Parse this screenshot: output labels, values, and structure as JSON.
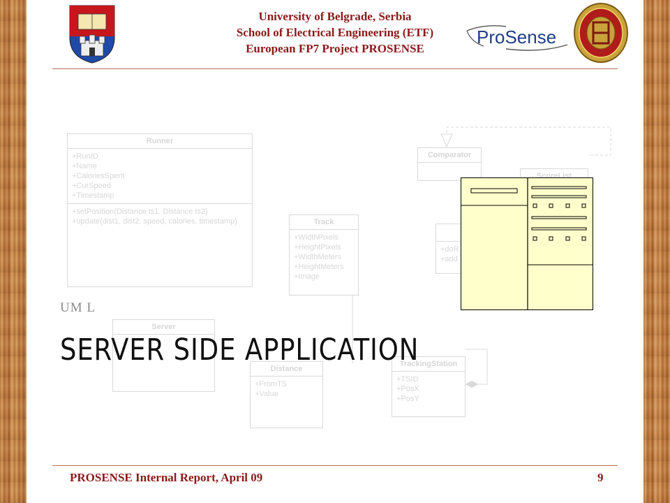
{
  "header": {
    "line1": "University of Belgrade, Serbia",
    "line2": "School of Electrical Engineering (ETF)",
    "line3": "European FP7 Project PROSENSE",
    "logo_text": "ProSense"
  },
  "slide": {
    "subtitle": "UM L",
    "title": "SERVER SIDE APPLICATION"
  },
  "uml": {
    "runner": {
      "name": "Runner",
      "attrs": [
        "+RunID",
        "+Name",
        "+CaloriesSpent",
        "+CurSpeed",
        "+Timestamp"
      ],
      "ops": [
        "+setPosition(Distance ts1, Distance ts2)",
        "+update(dist1, dist2, speed, calories, timestamp)"
      ]
    },
    "track": {
      "name": "Track",
      "attrs": [
        "+WidthPixels",
        "+HeightPixels",
        "+WidthMeters",
        "+HeightMeters",
        "+Image"
      ]
    },
    "comparator": {
      "name": "Comparator"
    },
    "scorelist": {
      "name": "ScoreList"
    },
    "server": {
      "name": "Server"
    },
    "distance": {
      "name": "Distance",
      "attrs": [
        "+FromTS",
        "+Value"
      ]
    },
    "trackingstation": {
      "name": "TrackingStation",
      "attrs": [
        "+TSID",
        "+PosX",
        "+PosY"
      ]
    },
    "partial": {
      "attrs": [
        "+doR",
        "+add"
      ]
    }
  },
  "footer": {
    "text": "PROSENSE Internal Report, April 09",
    "page": "9"
  },
  "colors": {
    "accent": "#8b1a1a",
    "rule": "#b87058",
    "icon_fill": "#ffffcc"
  }
}
